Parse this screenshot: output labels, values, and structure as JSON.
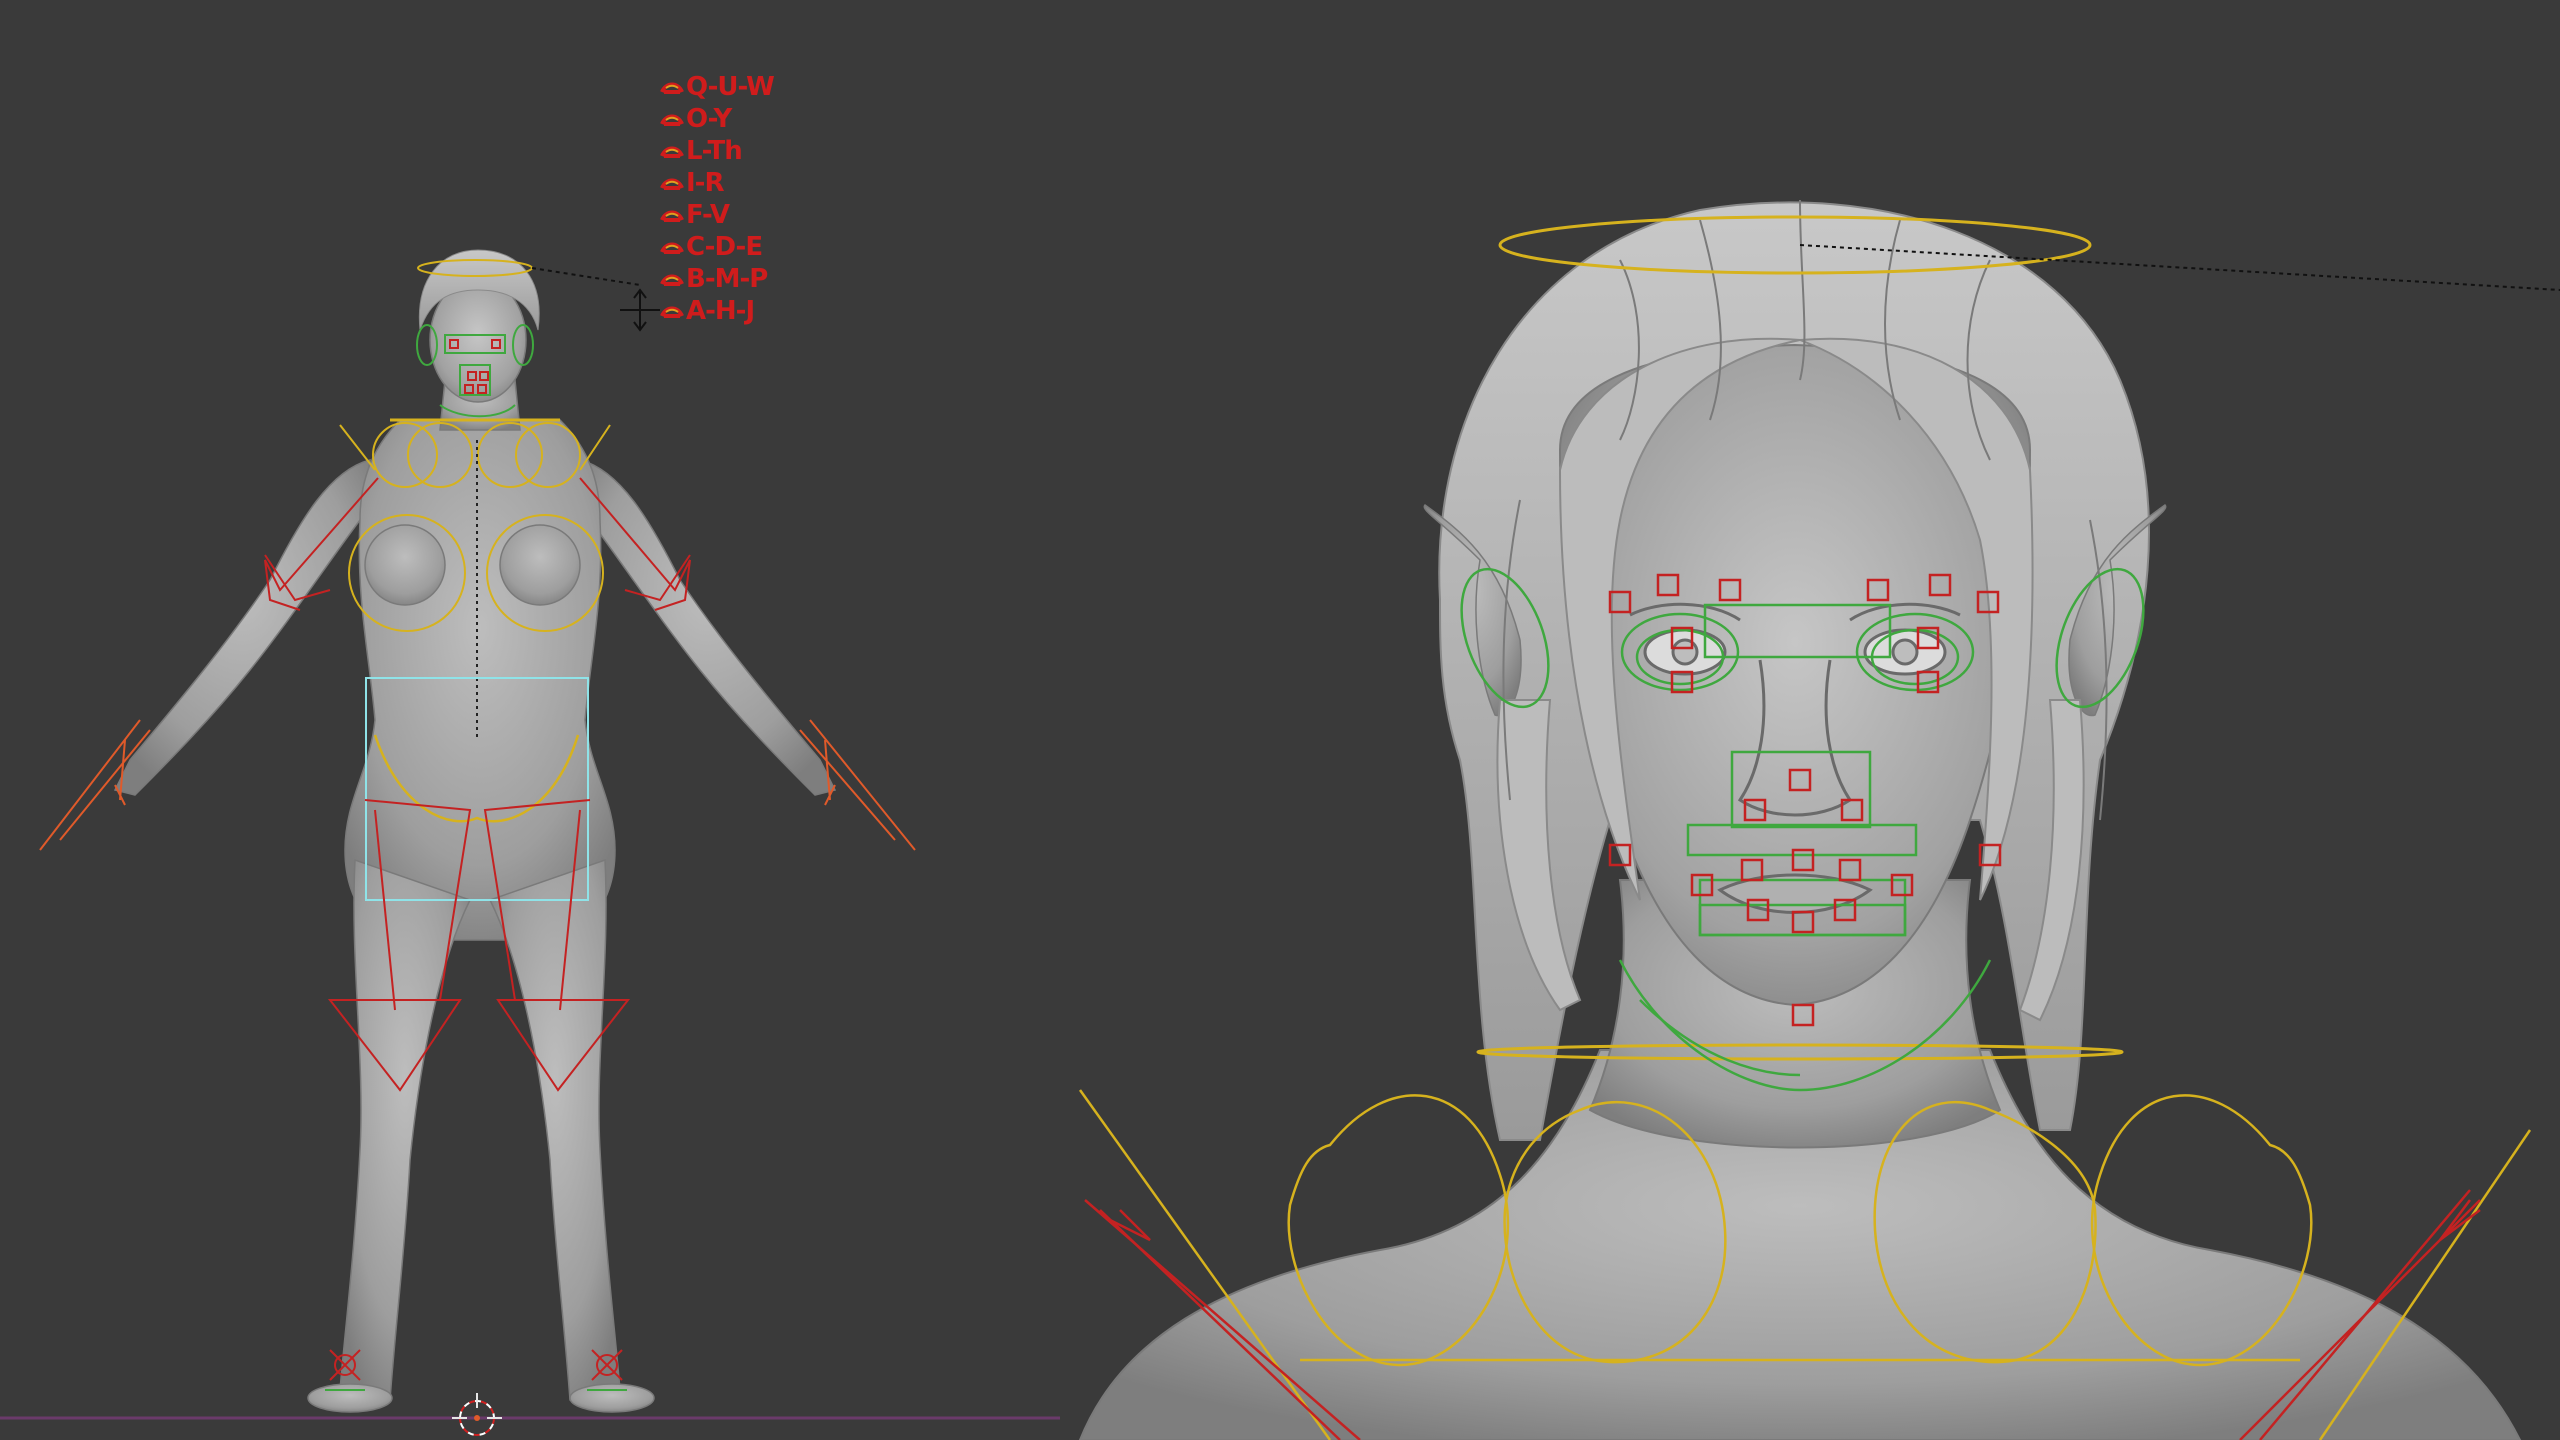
{
  "viewport": {
    "background": "#3a3a3a",
    "colors": {
      "mesh": "#a8a8a8",
      "mesh_shadow": "#8a8a8a",
      "hair": "#b4b4b4",
      "bone_red": "#c42222",
      "bone_yellow": "#d6b21e",
      "bone_green": "#3fa83f",
      "selection_cyan": "#8fe3e8",
      "ground_line": "#6a3a6a",
      "cursor": "#e6e6e6"
    }
  },
  "viseme_panel": {
    "icon": "mouth-shape-icon",
    "items": [
      {
        "label": "Q-U-W"
      },
      {
        "label": "O-Y"
      },
      {
        "label": "L-Th"
      },
      {
        "label": "I-R"
      },
      {
        "label": "F-V"
      },
      {
        "label": "C-D-E"
      },
      {
        "label": "B-M-P"
      },
      {
        "label": "A-H-J"
      }
    ]
  }
}
